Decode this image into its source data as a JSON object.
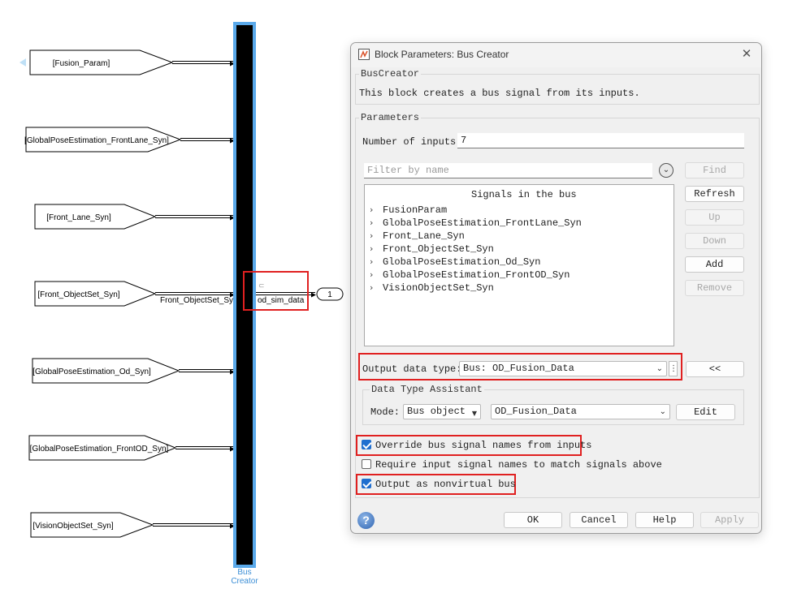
{
  "canvas": {
    "from_tags": [
      {
        "label": "[Fusion_Param]"
      },
      {
        "label": "[GlobalPoseEstimation_FrontLane_Syn]"
      },
      {
        "label": "[Front_Lane_Syn]"
      },
      {
        "label": "[Front_ObjectSet_Syn]"
      },
      {
        "label": "[GlobalPoseEstimation_Od_Syn]"
      },
      {
        "label": "[GlobalPoseEstimation_FrontOD_Syn]"
      },
      {
        "label": "[VisionObjectSet_Syn]"
      }
    ],
    "wire_label": "Front_ObjectSet_Syn",
    "output_signal_label": "od_sim_data",
    "outport_number": "1",
    "bus_creator_caption_line1": "Bus",
    "bus_creator_caption_line2": "Creator",
    "colors": {
      "selection": "#5aa9ea",
      "red_highlight": "#e02020"
    }
  },
  "dialog": {
    "title": "Block Parameters: Bus Creator",
    "block_type": "BusCreator",
    "description": "This block creates a bus signal from its inputs.",
    "parameters_label": "Parameters",
    "num_inputs_label": "Number of inputs:",
    "num_inputs_value": "7",
    "filter_placeholder": "Filter by name",
    "signals_header": "Signals in the bus",
    "signals": [
      "FusionParam",
      "GlobalPoseEstimation_FrontLane_Syn",
      "Front_Lane_Syn",
      "Front_ObjectSet_Syn",
      "GlobalPoseEstimation_Od_Syn",
      "GlobalPoseEstimation_FrontOD_Syn",
      "VisionObjectSet_Syn"
    ],
    "buttons": {
      "find": "Find",
      "refresh": "Refresh",
      "up": "Up",
      "down": "Down",
      "add": "Add",
      "remove": "Remove",
      "assistant_toggle": "<<",
      "edit": "Edit",
      "ok": "OK",
      "cancel": "Cancel",
      "help": "Help",
      "apply": "Apply"
    },
    "output_type_label": "Output data type:",
    "output_type_value": "Bus: OD_Fusion_Data",
    "assistant_label": "Data Type Assistant",
    "mode_label": "Mode:",
    "mode_value": "Bus object",
    "bus_object_value": "OD_Fusion_Data",
    "checkboxes": {
      "override_names": {
        "label": "Override bus signal names from inputs",
        "checked": true
      },
      "require_names": {
        "label": "Require input signal names to match signals above",
        "checked": false
      },
      "nonvirtual": {
        "label": "Output as nonvirtual bus",
        "checked": true
      }
    }
  }
}
